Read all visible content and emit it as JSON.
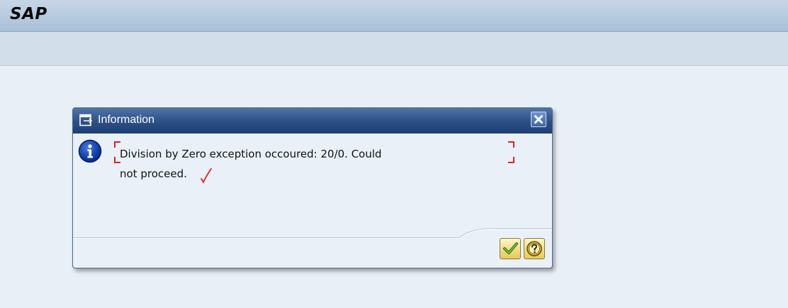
{
  "app": {
    "title": "SAP"
  },
  "dialog": {
    "title": "Information",
    "message_line1": "Division by Zero exception occoured: 20/0. Could",
    "message_line2": "not proceed.",
    "icons": {
      "header": "window-icon",
      "close": "close-icon",
      "message": "info-icon",
      "ok": "checkmark-icon",
      "help": "help-icon"
    }
  },
  "colors": {
    "header_blue": "#2c4f86",
    "annotation_red": "#e02020",
    "button_yellow": "#f2dc84"
  }
}
